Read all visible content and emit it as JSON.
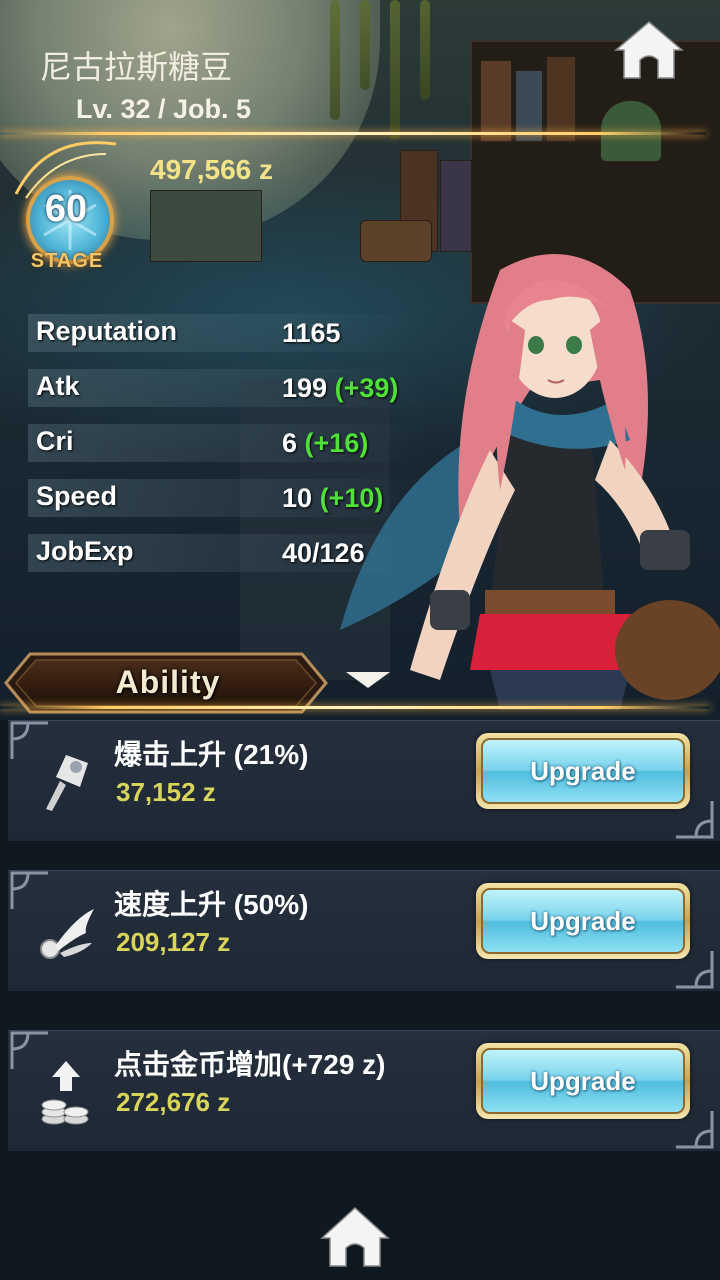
{
  "player": {
    "name": "尼古拉斯糖豆",
    "level_job": "Lv. 32 / Job. 5",
    "zeny": "497,566 z"
  },
  "stage": {
    "number": "60",
    "label": "STAGE"
  },
  "stats": [
    {
      "label": "Reputation",
      "value": "1165",
      "bonus": ""
    },
    {
      "label": "Atk",
      "value": "199",
      "bonus": "(+39)"
    },
    {
      "label": "Cri",
      "value": "6",
      "bonus": "(+16)"
    },
    {
      "label": "Speed",
      "value": "10",
      "bonus": "(+10)"
    },
    {
      "label": "JobExp",
      "value": "40/126",
      "bonus": ""
    }
  ],
  "ability_tab": {
    "label": "Ability"
  },
  "abilities": [
    {
      "title": "爆击上升 (21%)",
      "cost": "37,152 z",
      "button": "Upgrade",
      "icon": "critical-icon"
    },
    {
      "title": "速度上升 (50%)",
      "cost": "209,127 z",
      "button": "Upgrade",
      "icon": "speed-wing-icon"
    },
    {
      "title": "点击金币增加(+729 z)",
      "cost": "272,676 z",
      "button": "Upgrade",
      "icon": "coin-stack-icon"
    }
  ],
  "colors": {
    "bonus_green": "#4fe03a",
    "zeny_yellow": "#f3e48a",
    "gold_accent": "#ffcc66",
    "button_cyan": "#79d3ec"
  }
}
